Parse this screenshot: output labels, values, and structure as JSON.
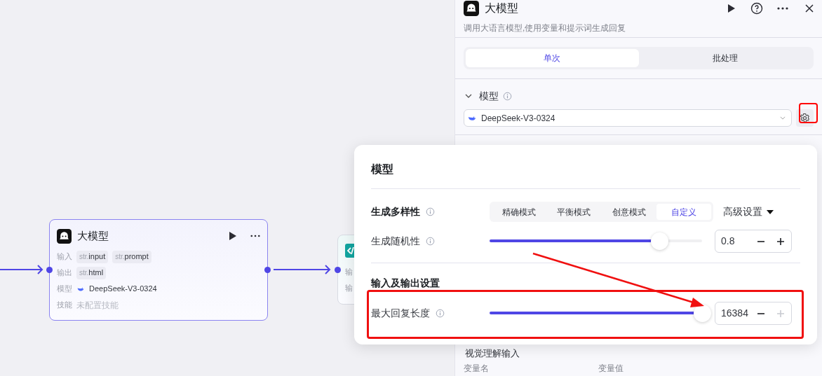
{
  "canvas": {
    "nodes": [
      {
        "kind": "llm",
        "title": "大模型",
        "rows": [
          {
            "label": "输入",
            "kind": "chips",
            "chips": [
              {
                "type": "str.",
                "name": "input"
              },
              {
                "type": "str.",
                "name": "prompt"
              }
            ]
          },
          {
            "label": "输出",
            "kind": "chips",
            "chips": [
              {
                "type": "str.",
                "name": "html"
              }
            ]
          },
          {
            "label": "模型",
            "kind": "model",
            "value": "DeepSeek-V3-0324"
          },
          {
            "label": "技能",
            "kind": "empty",
            "value": "未配置技能"
          }
        ]
      },
      {
        "kind": "code",
        "rows": [
          {
            "label": "输"
          },
          {
            "label": "输"
          }
        ]
      }
    ]
  },
  "panel": {
    "title": "大模型",
    "description": "调用大语言模型,使用变量和提示词生成回复",
    "tabs": [
      {
        "label": "单次",
        "selected": true
      },
      {
        "label": "批处理",
        "selected": false
      }
    ],
    "model_section": {
      "title": "模型",
      "expanded": true,
      "model": "DeepSeek-V3-0324"
    },
    "vision_section": {
      "title": "视觉理解输入",
      "columns": [
        "变量名",
        "变量值"
      ]
    }
  },
  "popup": {
    "title": "模型",
    "diversity": {
      "label": "生成多样性",
      "modes": [
        {
          "label": "精确模式",
          "selected": false
        },
        {
          "label": "平衡模式",
          "selected": false
        },
        {
          "label": "创意模式",
          "selected": false
        },
        {
          "label": "自定义",
          "selected": true
        }
      ],
      "advanced": "高级设置"
    },
    "randomness": {
      "label": "生成随机性",
      "level": 0.8,
      "value": "0.8",
      "minus_disabled": false,
      "plus_disabled": false
    },
    "io_title": "输入及输出设置",
    "max_length": {
      "label": "最大回复长度",
      "level": 1,
      "value": "16384",
      "minus_disabled": false,
      "plus_disabled": true
    }
  }
}
